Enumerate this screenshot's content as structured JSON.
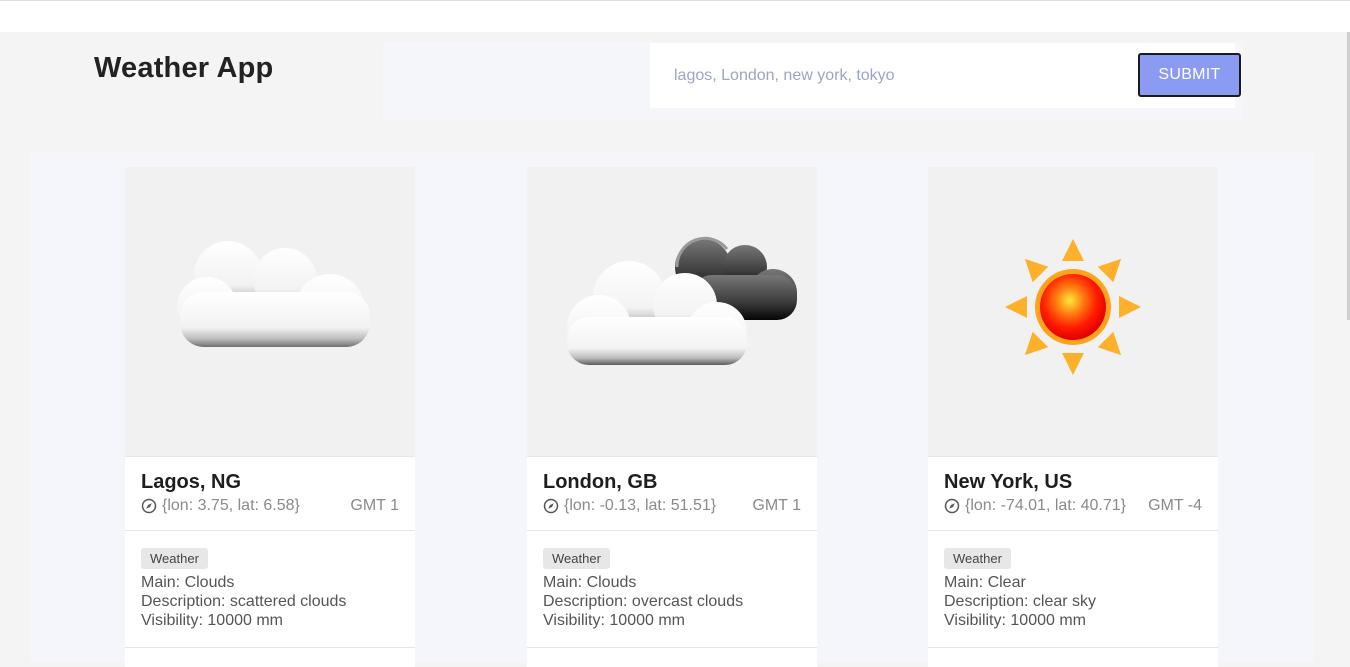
{
  "app": {
    "title": "Weather App"
  },
  "search": {
    "placeholder": "lagos, London, new york, tokyo",
    "submit_label": "SUBMIT"
  },
  "cards": [
    {
      "city": "Lagos, NG",
      "coords": "{lon: 3.75, lat: 6.58}",
      "gmt": "GMT 1",
      "tag": "Weather",
      "main": "Main: Clouds",
      "description": "Description: scattered clouds",
      "visibility": "Visibility: 10000 mm",
      "icon": "scattered-clouds-icon"
    },
    {
      "city": "London, GB",
      "coords": "{lon: -0.13, lat: 51.51}",
      "gmt": "GMT 1",
      "tag": "Weather",
      "main": "Main: Clouds",
      "description": "Description: overcast clouds",
      "visibility": "Visibility: 10000 mm",
      "icon": "overcast-clouds-icon"
    },
    {
      "city": "New York, US",
      "coords": "{lon: -74.01, lat: 40.71}",
      "gmt": "GMT -4",
      "tag": "Weather",
      "main": "Main: Clear",
      "description": "Description: clear sky",
      "visibility": "Visibility: 10000 mm",
      "icon": "clear-sky-sun-icon"
    }
  ],
  "colors": {
    "accent": "#8c9bf2",
    "background": "#f4f4f4",
    "card": "#ffffff"
  }
}
